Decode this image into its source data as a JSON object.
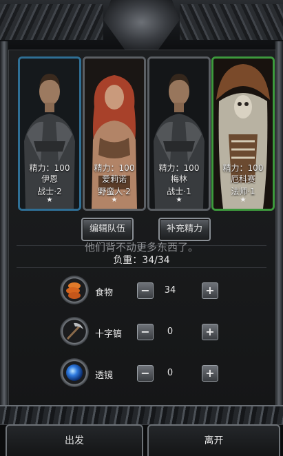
{
  "party": {
    "members": [
      {
        "energy": "精力：100",
        "name": "伊恩",
        "class": "战士·2",
        "star": "★",
        "frame": "#2f6f95"
      },
      {
        "energy": "精力：100",
        "name": "爱莉诺",
        "class": "野蛮人·2",
        "star": "★",
        "frame": "#5b5f64"
      },
      {
        "energy": "精力：100",
        "name": "梅林",
        "class": "战士·1",
        "star": "★",
        "frame": "#5b5f64"
      },
      {
        "energy": "精力：100",
        "name": "厄科赛",
        "class": "法师·1",
        "star": "★",
        "frame": "#3d9a3d"
      }
    ]
  },
  "buttons": {
    "edit_team": "编辑队伍",
    "restore_energy": "补充精力"
  },
  "hint": "他们背不动更多东西了。",
  "capacity": "负重：34/34",
  "supplies": [
    {
      "label": "食物",
      "value": "34",
      "icon": "food-icon"
    },
    {
      "label": "十字镐",
      "value": "0",
      "icon": "pickaxe-icon"
    },
    {
      "label": "透镜",
      "value": "0",
      "icon": "lens-icon"
    }
  ],
  "stepper": {
    "minus": "−",
    "plus": "+"
  },
  "footer": {
    "depart": "出发",
    "leave": "离开"
  }
}
